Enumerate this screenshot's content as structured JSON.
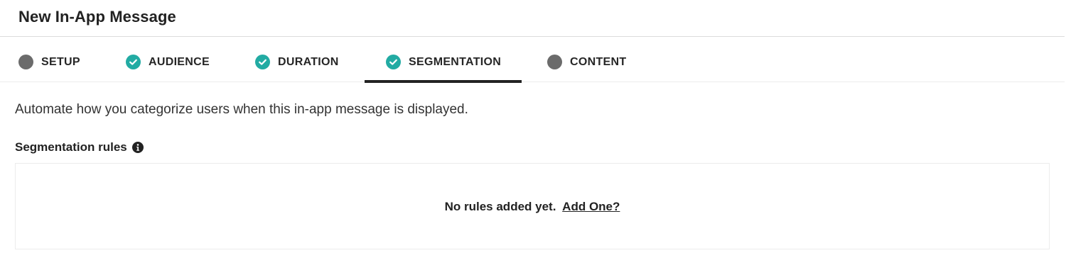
{
  "header": {
    "title": "New In-App Message"
  },
  "tabs": [
    {
      "label": "SETUP",
      "status": "pending",
      "icon": "pending-dot-icon"
    },
    {
      "label": "AUDIENCE",
      "status": "done",
      "icon": "check-circle-icon"
    },
    {
      "label": "DURATION",
      "status": "done",
      "icon": "check-circle-icon"
    },
    {
      "label": "SEGMENTATION",
      "status": "done",
      "icon": "check-circle-icon",
      "active": true
    },
    {
      "label": "CONTENT",
      "status": "pending",
      "icon": "pending-dot-icon"
    }
  ],
  "main": {
    "intro": "Automate how you categorize users when this in-app message is displayed.",
    "section_title": "Segmentation rules",
    "section_icon": "info-icon",
    "empty_text": "No rules added yet.",
    "add_link": "Add One?"
  },
  "colors": {
    "done": "#22aba3",
    "pending": "#6b6b6b",
    "active_underline": "#222222"
  }
}
